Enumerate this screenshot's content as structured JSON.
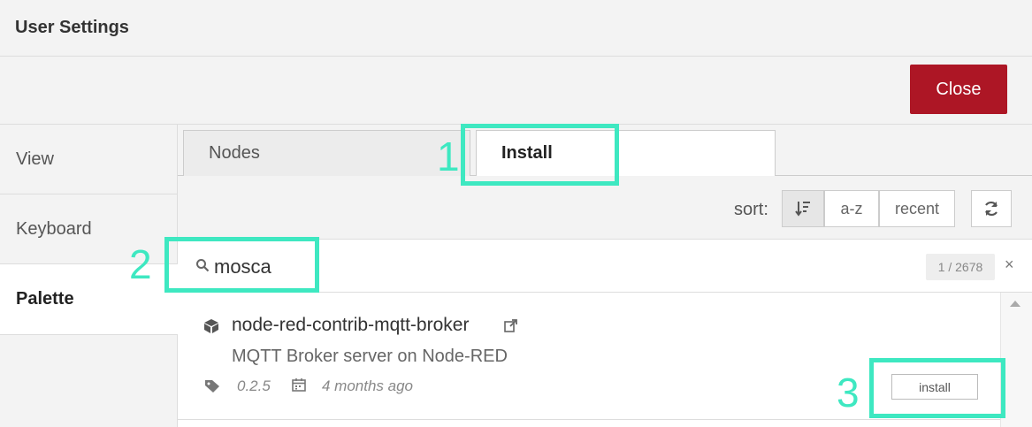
{
  "window": {
    "title": "User Settings"
  },
  "toolbar": {
    "close_label": "Close"
  },
  "sidebar": {
    "items": [
      {
        "label": "View"
      },
      {
        "label": "Keyboard"
      },
      {
        "label": "Palette"
      }
    ]
  },
  "tabs": [
    {
      "label": "Nodes"
    },
    {
      "label": "Install"
    }
  ],
  "sort": {
    "label": "sort:",
    "options": [
      "a-z",
      "recent"
    ]
  },
  "search": {
    "value": "mosca",
    "count": "1 / 2678",
    "clear": "×"
  },
  "results": [
    {
      "name": "node-red-contrib-mqtt-broker",
      "description": "MQTT Broker server on Node-RED",
      "version": "0.2.5",
      "updated": "4 months ago",
      "install_label": "install"
    }
  ],
  "annotations": [
    "1",
    "2",
    "3"
  ],
  "colors": {
    "close_button": "#ad1625",
    "highlight": "#3ee8c1"
  }
}
